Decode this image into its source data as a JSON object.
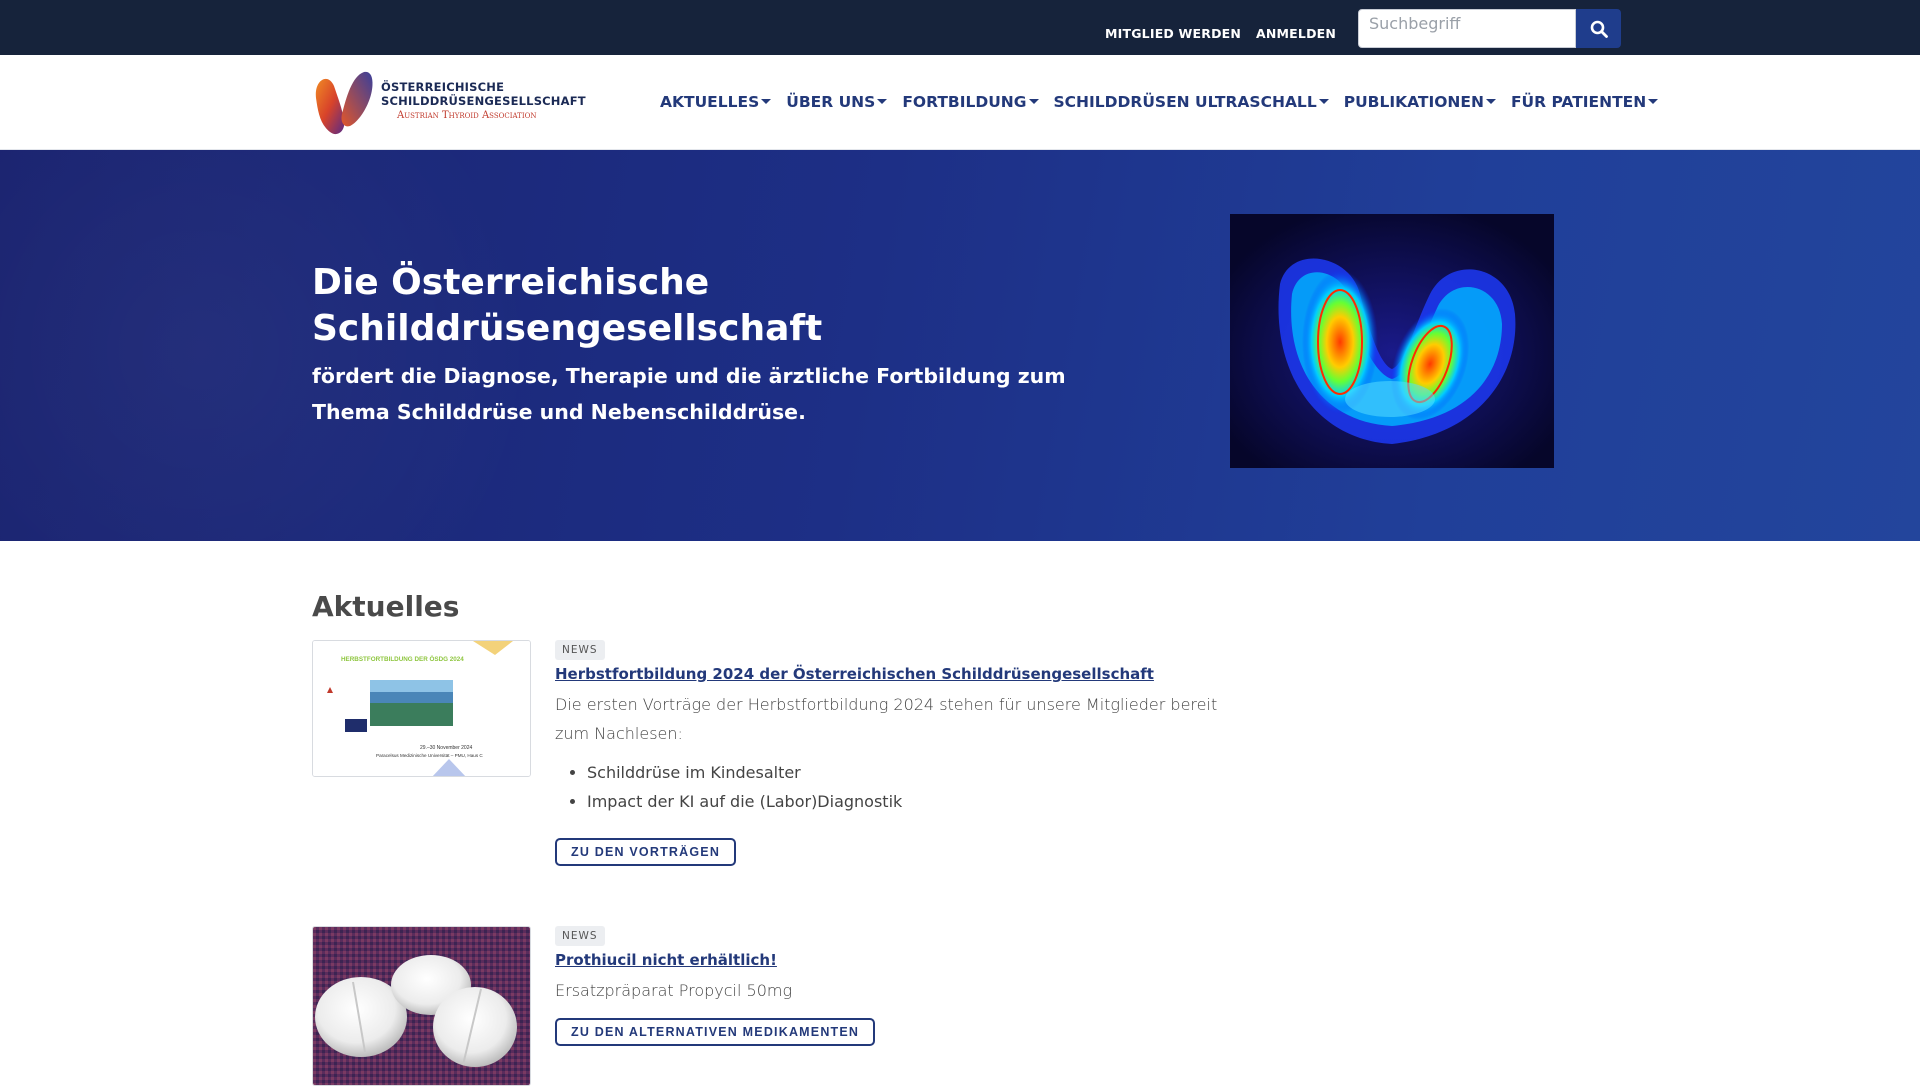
{
  "topbar": {
    "member_link": "MITGLIED WERDEN",
    "login_link": "ANMELDEN",
    "search_placeholder": "Suchbegriff"
  },
  "logo": {
    "line1": "ÖSTERREICHISCHE",
    "line2": "SCHILDDRÜSENGESELLSCHAFT",
    "line3": "Austrian Thyroid Association"
  },
  "nav": {
    "items": [
      {
        "label": "AKTUELLES"
      },
      {
        "label": "ÜBER UNS"
      },
      {
        "label": "FORTBILDUNG"
      },
      {
        "label": "SCHILDDRÜSEN ULTRASCHALL"
      },
      {
        "label": "PUBLIKATIONEN"
      },
      {
        "label": "FÜR PATIENTEN"
      }
    ]
  },
  "hero": {
    "title_line1": "Die Österreichische",
    "title_line2": "Schilddrüsengesellschaft",
    "subtitle": "fördert die Diagnose, Therapie und die ärztliche Fortbildung zum Thema Schilddrüse und Nebenschilddrüse."
  },
  "main": {
    "section_title": "Aktuelles",
    "news": [
      {
        "badge": "NEWS",
        "title": "Herbstfortbildung 2024 der Österreichischen Schilddrüsengesellschaft",
        "text": "Die ersten Vorträge der Herbstfortbildung 2024 stehen für unsere Mitglieder bereit zum Nachlesen:",
        "list": [
          "Schilddrüse im Kindesalter",
          "Impact der KI auf die (Labor)Diagnostik"
        ],
        "button": "ZU DEN VORTRÄGEN",
        "thumb_heading": "HERBSTFORTBILDUNG DER ÖSDG 2024",
        "thumb_date": "29.–30 November 2024",
        "thumb_place": "Paracelsus Medizinische Universität – PMU, Haus C"
      },
      {
        "badge": "NEWS",
        "title": "Prothiucil nicht erhältlich!",
        "text": "Ersatzpräparat Propycil 50mg",
        "button": "ZU DEN ALTERNATIVEN MEDIKAMENTEN"
      }
    ]
  },
  "colors": {
    "topbar": "#16233b",
    "brand_blue": "#23397a",
    "hero_start": "#1a2370",
    "hero_end": "#23459c",
    "search_button": "#1f3d8c"
  }
}
